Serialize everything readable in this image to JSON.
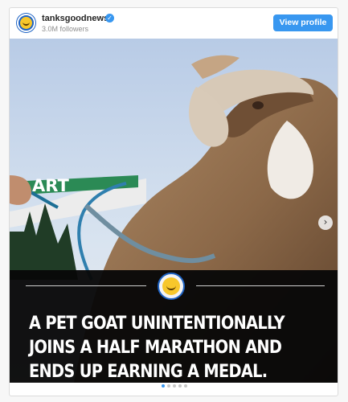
{
  "post": {
    "username": "tanksgoodnews",
    "followers": "3.0M followers",
    "view_profile_label": "View profile",
    "verified_icon": "check-badge-icon",
    "headline_lines": [
      "A PET GOAT UNINTENTIONALLY",
      "JOINS A HALF MARATHON AND",
      "ENDS UP EARNING A MEDAL."
    ],
    "carousel": {
      "slide_count": 5,
      "active_index": 0,
      "next_icon": "chevron-right-icon"
    },
    "colors": {
      "accent": "#3897f0",
      "brand_blue": "#1e63c4",
      "overlay": "#080808"
    }
  }
}
